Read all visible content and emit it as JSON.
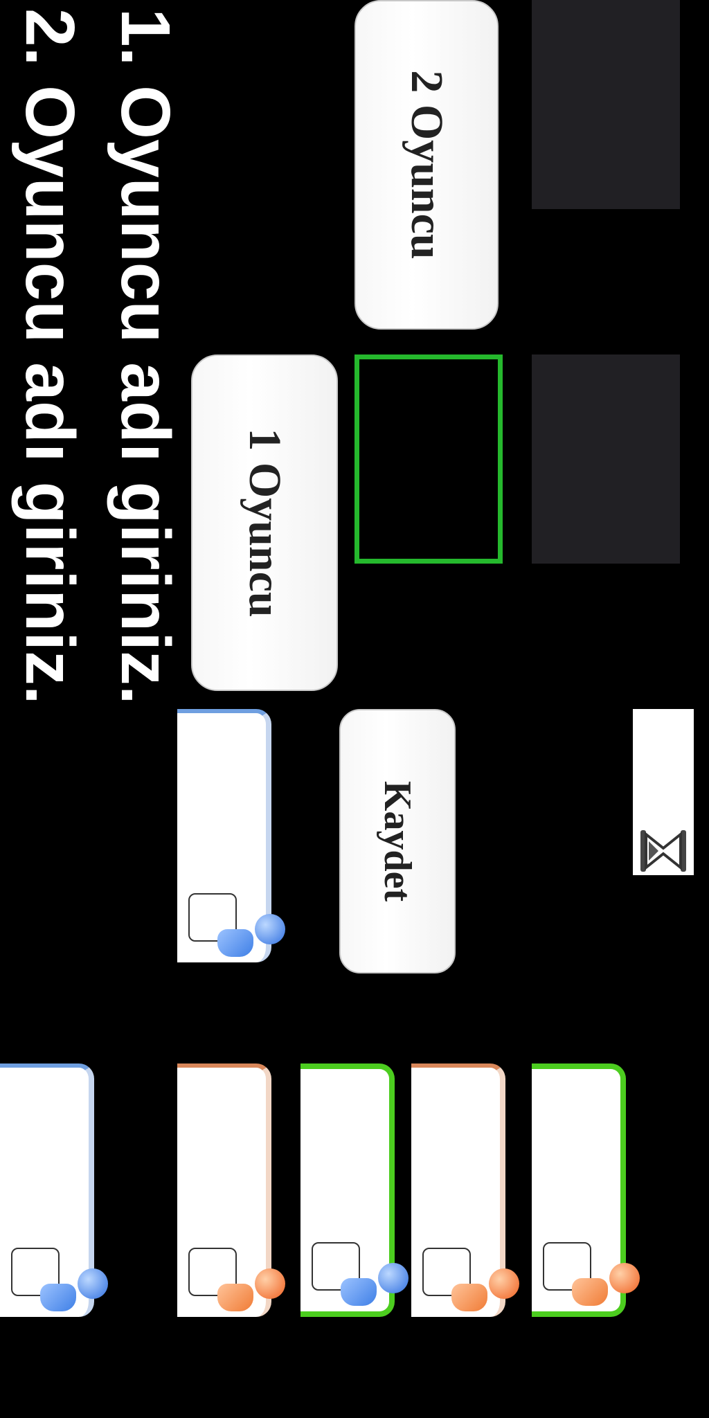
{
  "prompts": {
    "player1": "1. Oyuncu adı giriniz.",
    "player2": "2. Oyuncu adı giriniz."
  },
  "buttons": {
    "one_player": "1 Oyuncu",
    "two_player": "2 Oyuncu",
    "save": "Kaydet"
  },
  "icons": {
    "hourglass": "hourglass-icon",
    "avatar": "user-avatar-icon"
  },
  "colors": {
    "background": "#000000",
    "panel": "#212024",
    "selection": "#25b82d",
    "card_green": "#4ccd1f",
    "avatar_blue": "#3f7fe6",
    "avatar_orange": "#f07b35"
  }
}
